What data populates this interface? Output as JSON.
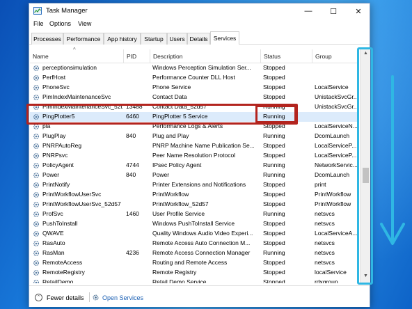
{
  "window": {
    "title": "Task Manager",
    "controls": {
      "minimize": "—",
      "maximize": "☐",
      "close": "✕"
    }
  },
  "menu": [
    "File",
    "Options",
    "View"
  ],
  "tabs": [
    "Processes",
    "Performance",
    "App history",
    "Startup",
    "Users",
    "Details",
    "Services"
  ],
  "active_tab": "Services",
  "columns": [
    "Name",
    "PID",
    "Description",
    "Status",
    "Group"
  ],
  "rows": [
    {
      "name": "perceptionsimulation",
      "pid": "",
      "description": "Windows Perception Simulation Ser...",
      "status": "Stopped",
      "group": ""
    },
    {
      "name": "PerfHost",
      "pid": "",
      "description": "Performance Counter DLL Host",
      "status": "Stopped",
      "group": ""
    },
    {
      "name": "PhoneSvc",
      "pid": "",
      "description": "Phone Service",
      "status": "Stopped",
      "group": "LocalService"
    },
    {
      "name": "PimIndexMaintenanceSvc",
      "pid": "",
      "description": "Contact Data",
      "status": "Stopped",
      "group": "UnistackSvcGr..."
    },
    {
      "name": "PimIndexMaintenanceSvc_52d57",
      "pid": "13488",
      "description": "Contact Data_52d57",
      "status": "Running",
      "group": "UnistackSvcGr..."
    },
    {
      "name": "PingPlotter5",
      "pid": "6460",
      "description": "PingPlotter 5 Service",
      "status": "Running",
      "group": ""
    },
    {
      "name": "pla",
      "pid": "",
      "description": "Performance Logs & Alerts",
      "status": "Stopped",
      "group": "LocalServiceN..."
    },
    {
      "name": "PlugPlay",
      "pid": "840",
      "description": "Plug and Play",
      "status": "Running",
      "group": "DcomLaunch"
    },
    {
      "name": "PNRPAutoReg",
      "pid": "",
      "description": "PNRP Machine Name Publication Se...",
      "status": "Stopped",
      "group": "LocalServiceP..."
    },
    {
      "name": "PNRPsvc",
      "pid": "",
      "description": "Peer Name Resolution Protocol",
      "status": "Stopped",
      "group": "LocalServiceP..."
    },
    {
      "name": "PolicyAgent",
      "pid": "4744",
      "description": "IPsec Policy Agent",
      "status": "Running",
      "group": "NetworkServic..."
    },
    {
      "name": "Power",
      "pid": "840",
      "description": "Power",
      "status": "Running",
      "group": "DcomLaunch"
    },
    {
      "name": "PrintNotify",
      "pid": "",
      "description": "Printer Extensions and Notifications",
      "status": "Stopped",
      "group": "print"
    },
    {
      "name": "PrintWorkflowUserSvc",
      "pid": "",
      "description": "PrintWorkflow",
      "status": "Stopped",
      "group": "PrintWorkflow"
    },
    {
      "name": "PrintWorkflowUserSvc_52d57",
      "pid": "",
      "description": "PrintWorkflow_52d57",
      "status": "Stopped",
      "group": "PrintWorkflow"
    },
    {
      "name": "ProfSvc",
      "pid": "1460",
      "description": "User Profile Service",
      "status": "Running",
      "group": "netsvcs"
    },
    {
      "name": "PushToInstall",
      "pid": "",
      "description": "Windows PushToInstall Service",
      "status": "Stopped",
      "group": "netsvcs"
    },
    {
      "name": "QWAVE",
      "pid": "",
      "description": "Quality Windows Audio Video Experi...",
      "status": "Stopped",
      "group": "LocalServiceA..."
    },
    {
      "name": "RasAuto",
      "pid": "",
      "description": "Remote Access Auto Connection M...",
      "status": "Stopped",
      "group": "netsvcs"
    },
    {
      "name": "RasMan",
      "pid": "4236",
      "description": "Remote Access Connection Manager",
      "status": "Running",
      "group": "netsvcs"
    },
    {
      "name": "RemoteAccess",
      "pid": "",
      "description": "Routing and Remote Access",
      "status": "Stopped",
      "group": "netsvcs"
    },
    {
      "name": "RemoteRegistry",
      "pid": "",
      "description": "Remote Registry",
      "status": "Stopped",
      "group": "localService"
    },
    {
      "name": "RetailDemo",
      "pid": "",
      "description": "Retail Demo Service",
      "status": "Stopped",
      "group": "rdxgroup"
    }
  ],
  "selected_row": "PingPlotter5",
  "footer": {
    "fewer_details": "Fewer details",
    "open_services": "Open Services"
  },
  "colors": {
    "highlight_red": "#b3241e",
    "highlight_blue": "#2fb7e3",
    "selection": "#dcebfb"
  }
}
